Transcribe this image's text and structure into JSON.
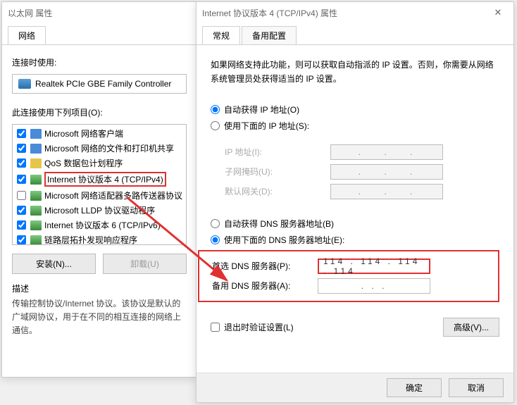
{
  "left": {
    "title": "以太网 属性",
    "tab_network": "网络",
    "connect_using": "连接时使用:",
    "adapter": "Realtek PCIe GBE Family Controller",
    "items_label": "此连接使用下列项目(O):",
    "items": [
      "Microsoft 网络客户端",
      "Microsoft 网络的文件和打印机共享",
      "QoS 数据包计划程序",
      "Internet 协议版本 4 (TCP/IPv4)",
      "Microsoft 网络适配器多路传送器协议",
      "Microsoft LLDP 协议驱动程序",
      "Internet 协议版本 6 (TCP/IPv6)",
      "链路层拓扑发现响应程序"
    ],
    "install": "安装(N)...",
    "uninstall": "卸载(U)",
    "desc_label": "描述",
    "desc": "传输控制协议/Internet 协议。该协议是默认的广域网协议，用于在不同的相互连接的网络上通信。"
  },
  "right": {
    "title": "Internet 协议版本 4 (TCP/IPv4) 属性",
    "tab_general": "常规",
    "tab_alt": "备用配置",
    "intro": "如果网络支持此功能，则可以获取自动指派的 IP 设置。否则，你需要从网络系统管理员处获得适当的 IP 设置。",
    "auto_ip": "自动获得 IP 地址(O)",
    "manual_ip": "使用下面的 IP 地址(S):",
    "ip_label": "IP 地址(I):",
    "mask_label": "子网掩码(U):",
    "gw_label": "默认网关(D):",
    "auto_dns": "自动获得 DNS 服务器地址(B)",
    "manual_dns": "使用下面的 DNS 服务器地址(E):",
    "pref_dns": "首选 DNS 服务器(P):",
    "alt_dns": "备用 DNS 服务器(A):",
    "pref_value": "114 . 114 . 114 . 114",
    "alt_value": ".       .       .",
    "validate": "退出时验证设置(L)",
    "advanced": "高级(V)...",
    "ok": "确定",
    "cancel": "取消"
  }
}
